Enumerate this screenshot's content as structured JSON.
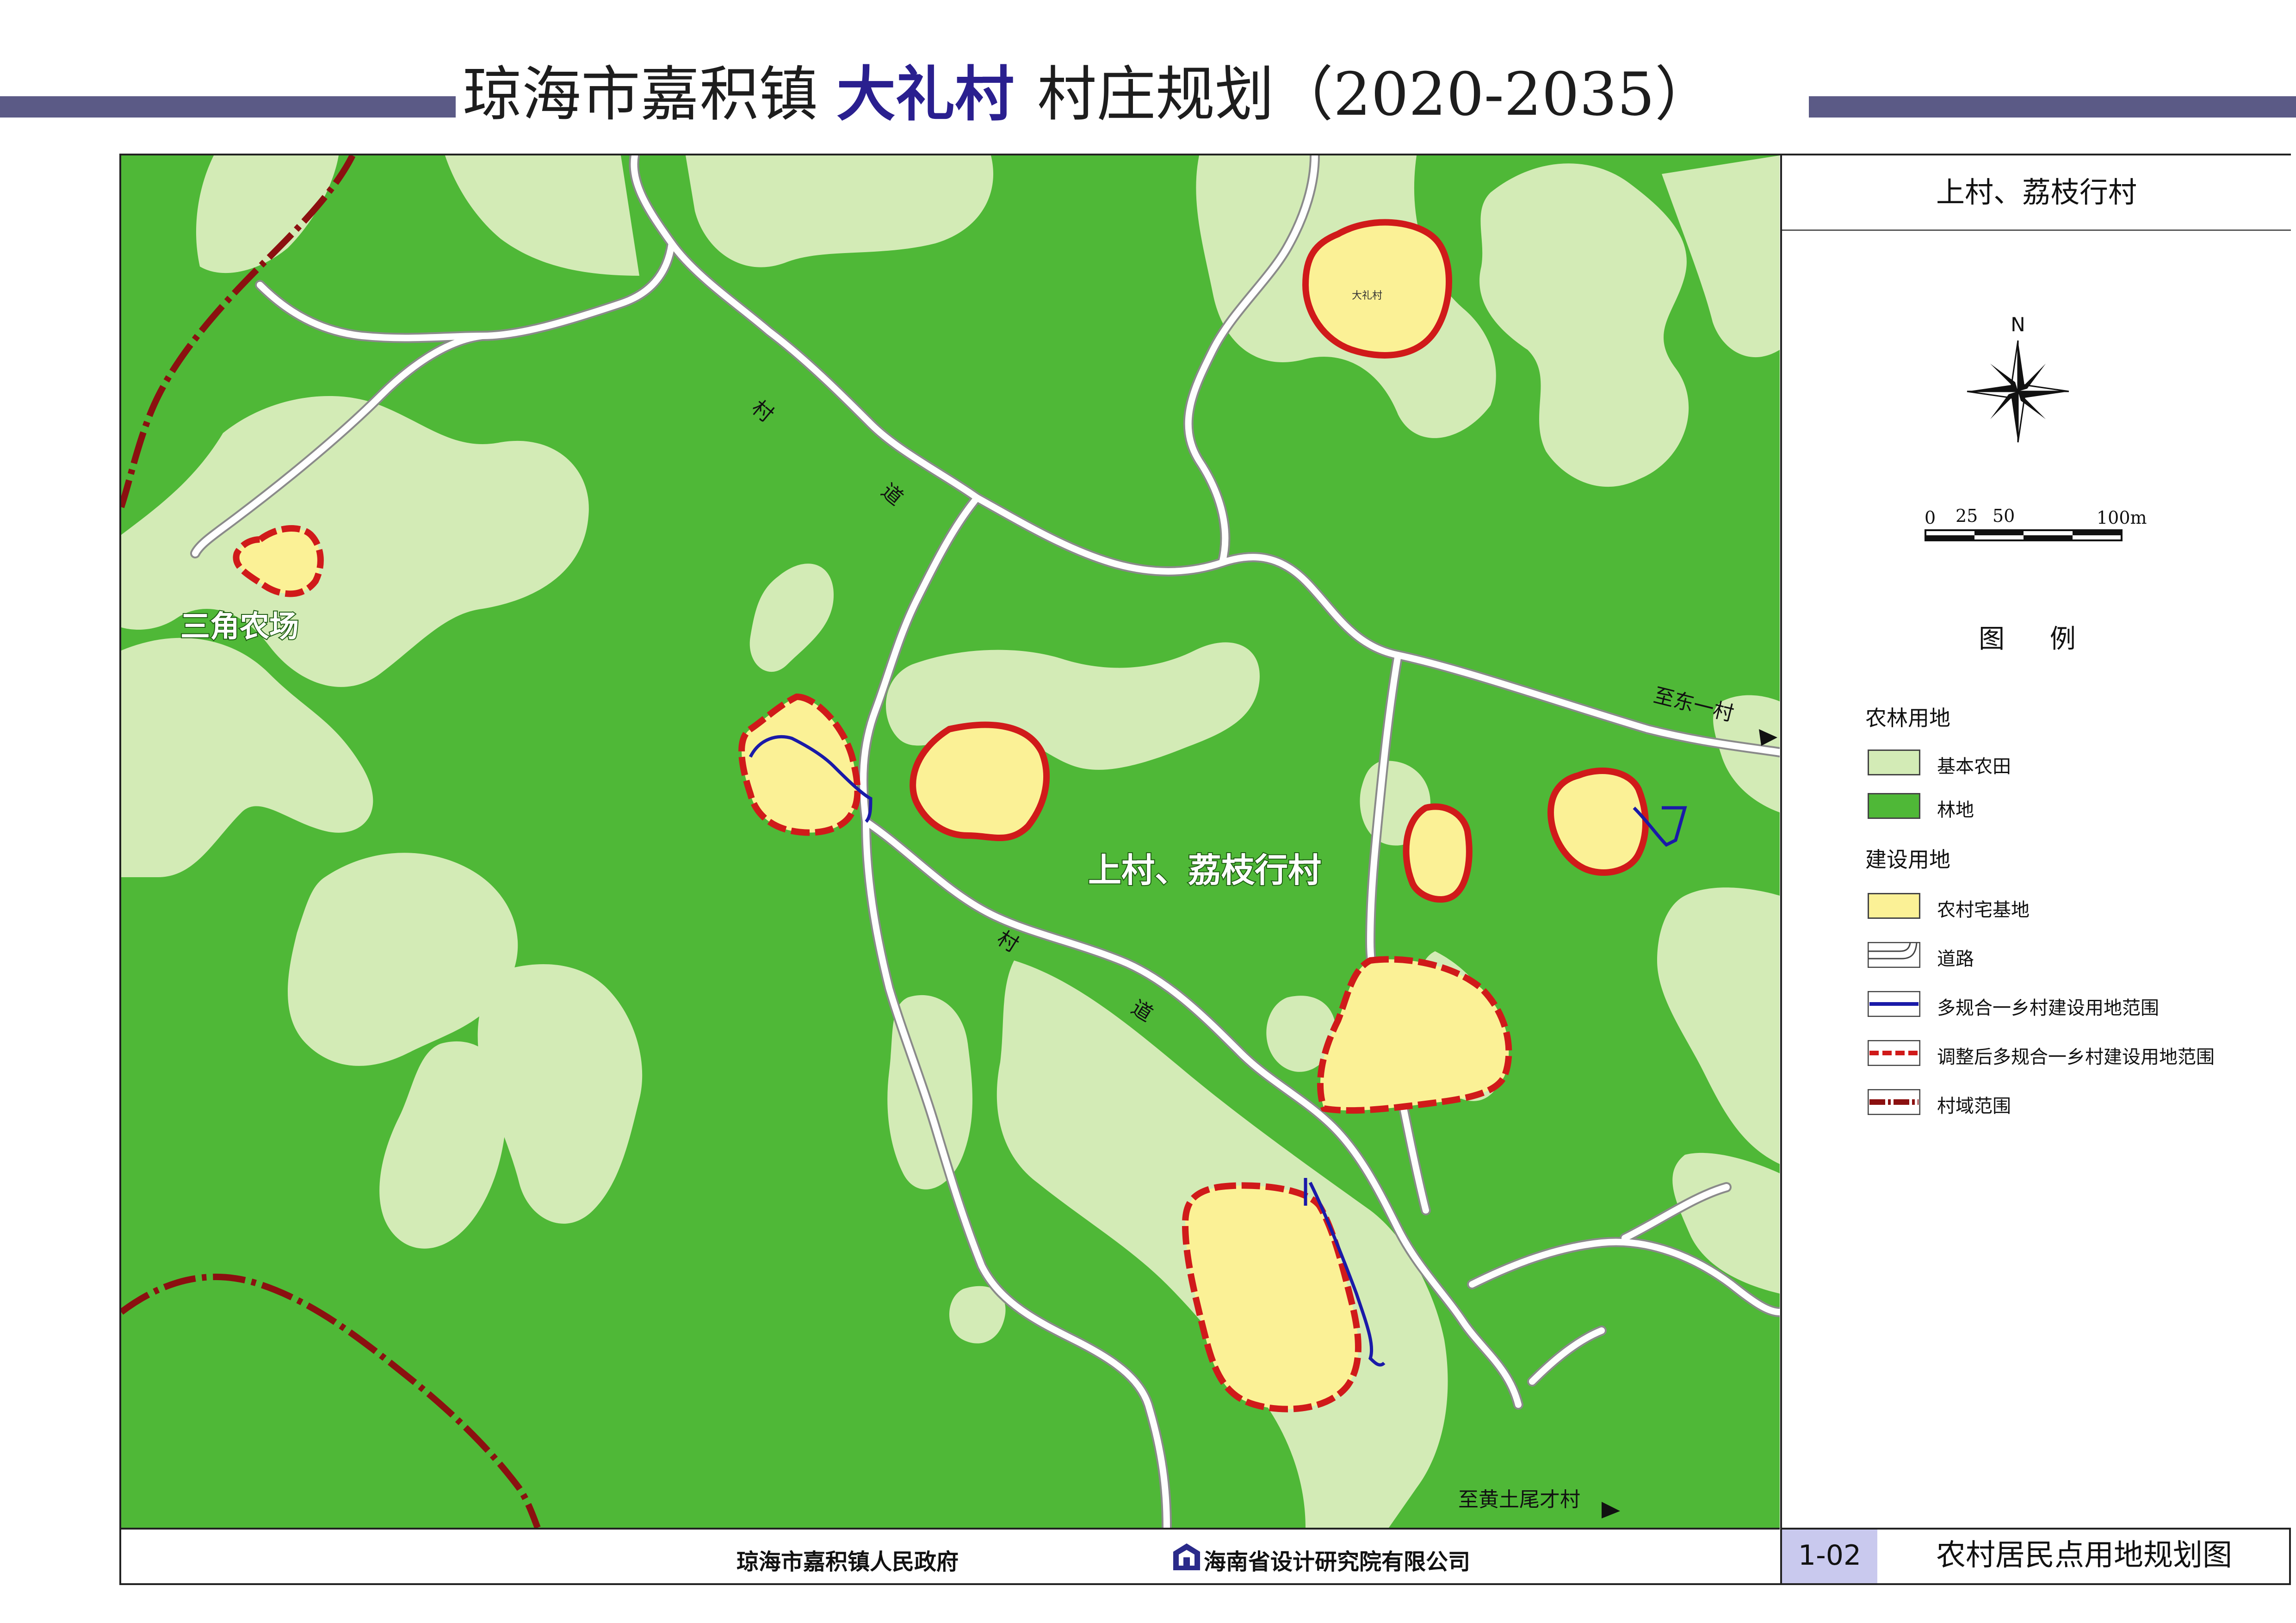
{
  "header": {
    "title_prefix": "琼海市嘉积镇",
    "title_village": "大礼村",
    "title_suffix": "村庄规划（2020-2035）"
  },
  "panel": {
    "title": "上村、荔枝行村",
    "north": "N",
    "scale_labels": [
      "0",
      "25",
      "50",
      "100m"
    ],
    "legend_title": "图 例",
    "legend": [
      {
        "section": "农林用地",
        "items": [
          {
            "label": "基本农田",
            "swatch": "farmland"
          },
          {
            "label": "林地",
            "swatch": "forest"
          }
        ]
      },
      {
        "section": "建设用地",
        "items": [
          {
            "label": "农村宅基地",
            "swatch": "residential"
          },
          {
            "label": "道路",
            "swatch": "road"
          },
          {
            "label": "多规合一乡村建设用地范围",
            "swatch": "blue-line"
          },
          {
            "label": "调整后多规合一乡村建设用地范围",
            "swatch": "red-dashed"
          },
          {
            "label": "村域范围",
            "swatch": "boundary"
          }
        ]
      }
    ]
  },
  "map": {
    "labels": {
      "farm": "三角农场",
      "village": "上村、荔枝行村",
      "dali": "大礼村",
      "road_1a": "村",
      "road_1b": "道",
      "road_2a": "村",
      "road_2b": "道",
      "to_dongyi": "至东一村",
      "to_huangtu": "至黄土尾才村"
    }
  },
  "footer": {
    "government": "琼海市嘉积镇人民政府",
    "institute": "海南省设计研究院有限公司",
    "drawing_no": "1-02",
    "drawing_name": "农村居民点用地规划图"
  },
  "colors": {
    "forest": "#4fb837",
    "farmland": "#d3ebb6",
    "residential": "#fbf196",
    "boundary_red": "#d01a1a",
    "scope_blue": "#1a1aa8",
    "title_bar": "#5b5a86",
    "drawing_code_bg": "#c9c9ee"
  }
}
